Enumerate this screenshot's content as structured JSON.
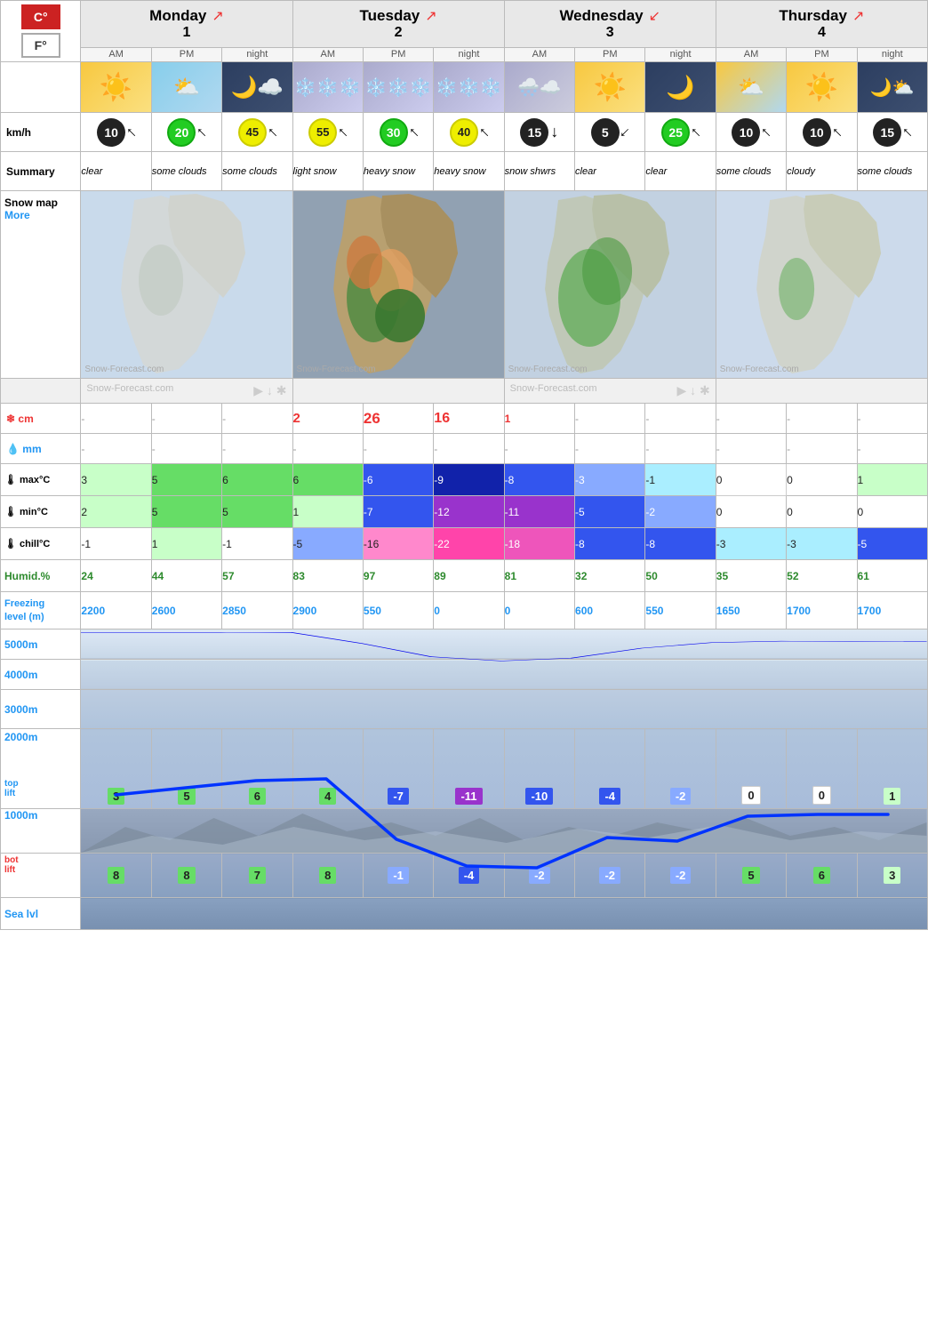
{
  "units": {
    "celsius_label": "C°",
    "fahrenheit_label": "F°"
  },
  "days": [
    {
      "name": "Monday",
      "num": "1",
      "periods": [
        "AM",
        "PM",
        "night"
      ],
      "wind": [
        {
          "speed": 10,
          "color": "black",
          "arrow": "↗"
        },
        {
          "speed": 20,
          "color": "green",
          "arrow": "↗"
        },
        {
          "speed": 45,
          "color": "yellow",
          "arrow": "↗"
        }
      ],
      "summary": [
        "clear",
        "some clouds",
        "some clouds"
      ],
      "weather_icons": [
        "sun",
        "sun-cloud",
        "cloud-night"
      ],
      "snow_cm": [
        "-",
        "-",
        "-"
      ],
      "rain_mm": [
        "-",
        "-",
        "-"
      ],
      "max_c": [
        3,
        5,
        6
      ],
      "min_c": [
        2,
        5,
        5
      ],
      "chill_c": [
        -1,
        1,
        -1
      ],
      "humid": [
        24,
        44,
        57
      ],
      "freezing": [
        2200,
        2600,
        2850
      ],
      "top_lift": [
        3,
        5,
        6
      ],
      "bot_lift": [
        8,
        8,
        7
      ]
    },
    {
      "name": "Tuesday",
      "num": "2",
      "periods": [
        "AM",
        "PM",
        "night"
      ],
      "wind": [
        {
          "speed": 55,
          "color": "yellow",
          "arrow": "↗"
        },
        {
          "speed": 30,
          "color": "green",
          "arrow": "↗"
        },
        {
          "speed": 40,
          "color": "yellow",
          "arrow": "↗"
        }
      ],
      "summary": [
        "light snow",
        "heavy snow",
        "heavy snow"
      ],
      "weather_icons": [
        "snow",
        "snow",
        "snow"
      ],
      "snow_cm": [
        2,
        26,
        16
      ],
      "rain_mm": [
        "-",
        "-",
        "-"
      ],
      "max_c": [
        6,
        -6,
        -9
      ],
      "min_c": [
        1,
        -7,
        -12
      ],
      "chill_c": [
        -5,
        -16,
        -22
      ],
      "humid": [
        83,
        97,
        89
      ],
      "freezing": [
        2900,
        550,
        0
      ],
      "top_lift": [
        4,
        -7,
        -11
      ],
      "bot_lift": [
        8,
        -1,
        -4
      ]
    },
    {
      "name": "Wednesday",
      "num": "3",
      "periods": [
        "AM",
        "PM",
        "night"
      ],
      "wind": [
        {
          "speed": 15,
          "color": "black",
          "arrow": "↓"
        },
        {
          "speed": 5,
          "color": "black",
          "arrow": "↘"
        },
        {
          "speed": 25,
          "color": "green",
          "arrow": "↗"
        }
      ],
      "summary": [
        "snow shwrs",
        "clear",
        "clear"
      ],
      "weather_icons": [
        "snow-cloud",
        "sun",
        "moon"
      ],
      "snow_cm": [
        1,
        "-",
        "-"
      ],
      "rain_mm": [
        "-",
        "-",
        "-"
      ],
      "max_c": [
        -8,
        -3,
        -1
      ],
      "min_c": [
        -11,
        -5,
        -2
      ],
      "chill_c": [
        -18,
        -8,
        -8
      ],
      "humid": [
        81,
        32,
        50
      ],
      "freezing": [
        0,
        600,
        550
      ],
      "top_lift": [
        -10,
        -4,
        -2
      ],
      "bot_lift": [
        -2,
        -2,
        -2
      ]
    },
    {
      "name": "Thursday",
      "num": "4",
      "periods": [
        "AM",
        "PM",
        "night"
      ],
      "wind": [
        {
          "speed": 10,
          "color": "black",
          "arrow": "↗"
        },
        {
          "speed": 10,
          "color": "black",
          "arrow": "↗"
        },
        {
          "speed": 15,
          "color": "black",
          "arrow": "↗"
        }
      ],
      "summary": [
        "some clouds",
        "cloudy",
        "some clouds"
      ],
      "weather_icons": [
        "sun-cloud",
        "sun",
        "cloud-moon"
      ],
      "snow_cm": [
        "-",
        "-",
        "-"
      ],
      "rain_mm": [
        "-",
        "-",
        "-"
      ],
      "max_c": [
        0,
        0,
        1
      ],
      "min_c": [
        0,
        0,
        0
      ],
      "chill_c": [
        -3,
        -3,
        -5
      ],
      "humid": [
        35,
        52,
        61
      ],
      "freezing": [
        1650,
        1700,
        1700
      ],
      "top_lift": [
        0,
        0,
        1
      ],
      "bot_lift": [
        5,
        6,
        3
      ]
    }
  ],
  "row_labels": {
    "kmh": "km/h",
    "summary": "Summary",
    "snowmap": "Snow map",
    "more": "More",
    "snow_cm": "❄ cm",
    "rain_mm": "💧 mm",
    "max": "🌡 max°C",
    "min": "🌡 min°C",
    "chill": "🌡 chill°C",
    "humid": "Humid.%",
    "freezing": "Freezing\nlevel (m)",
    "alt_5000": "5000m",
    "alt_4000": "4000m",
    "alt_3000": "3000m",
    "alt_2000": "2000m",
    "top_lift": "top\nlift",
    "alt_1000": "1000m",
    "bot_lift": "bot\nlift",
    "sea": "Sea lvl"
  },
  "watermark": "Snow-Forecast.com"
}
